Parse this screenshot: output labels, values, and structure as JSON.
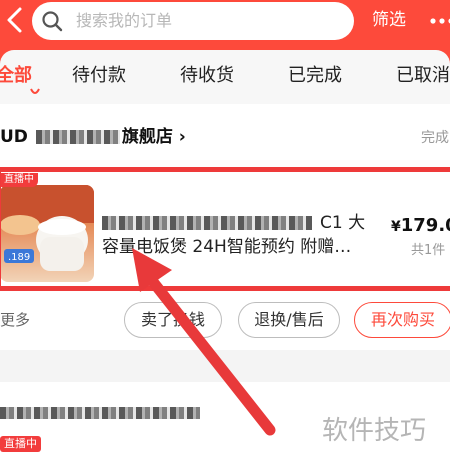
{
  "search": {
    "placeholder": "搜索我的订单"
  },
  "header": {
    "filter_label": "筛选"
  },
  "tabs": [
    {
      "label": "全部",
      "active": true
    },
    {
      "label": "待付款"
    },
    {
      "label": "待收货"
    },
    {
      "label": "已完成"
    },
    {
      "label": "已取消"
    }
  ],
  "order": {
    "store_prefix": "UD",
    "store_suffix": "旗舰店",
    "status": "完成",
    "live_badge": "直播中",
    "thumb_price": ".189",
    "title_line1_visible": "C1 大",
    "title_line2": "容量电饭煲 24H智能预约 附赠…",
    "price_symbol": "¥",
    "price": "179.00",
    "quantity": "共1件",
    "more_label": "更多",
    "buttons": {
      "sell": "卖了换钱",
      "refund": "退换/售后",
      "rebuy": "再次购买"
    }
  },
  "order2": {
    "live_badge": "直播中"
  },
  "watermark": "软件技巧",
  "colors": {
    "brand": "#fd4a3b",
    "highlight": "#ee3a3a"
  }
}
